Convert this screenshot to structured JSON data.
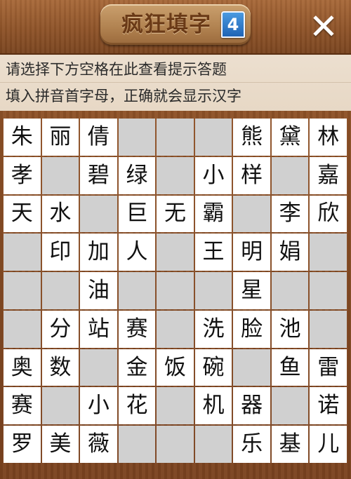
{
  "header": {
    "title": "疯狂填字",
    "level_badge": "4",
    "close_label": "✕"
  },
  "hints": {
    "line1": "请选择下方空格在此查看提示答题",
    "line2": "填入拼音首字母，正确就会显示汉字"
  },
  "grid": {
    "rows": [
      [
        "朱",
        "丽",
        "倩",
        "",
        "",
        "",
        "熊",
        "黛",
        "林"
      ],
      [
        "孝",
        "",
        "碧",
        "绿",
        "",
        "小",
        "样",
        "",
        "嘉"
      ],
      [
        "天",
        "水",
        "",
        "巨",
        "无",
        "霸",
        "",
        "李",
        "欣"
      ],
      [
        "",
        "印",
        "加",
        "人",
        "",
        "王",
        "明",
        "娟",
        ""
      ],
      [
        "",
        "",
        "油",
        "",
        "",
        "",
        "星",
        "",
        ""
      ],
      [
        "",
        "分",
        "站",
        "赛",
        "",
        "洗",
        "脸",
        "池",
        ""
      ],
      [
        "奥",
        "数",
        "",
        "金",
        "饭",
        "碗",
        "",
        "鱼",
        "雷"
      ],
      [
        "赛",
        "",
        "小",
        "花",
        "",
        "机",
        "器",
        "",
        "诺"
      ],
      [
        "罗",
        "美",
        "薇",
        "",
        "",
        "",
        "乐",
        "基",
        "儿"
      ]
    ]
  }
}
